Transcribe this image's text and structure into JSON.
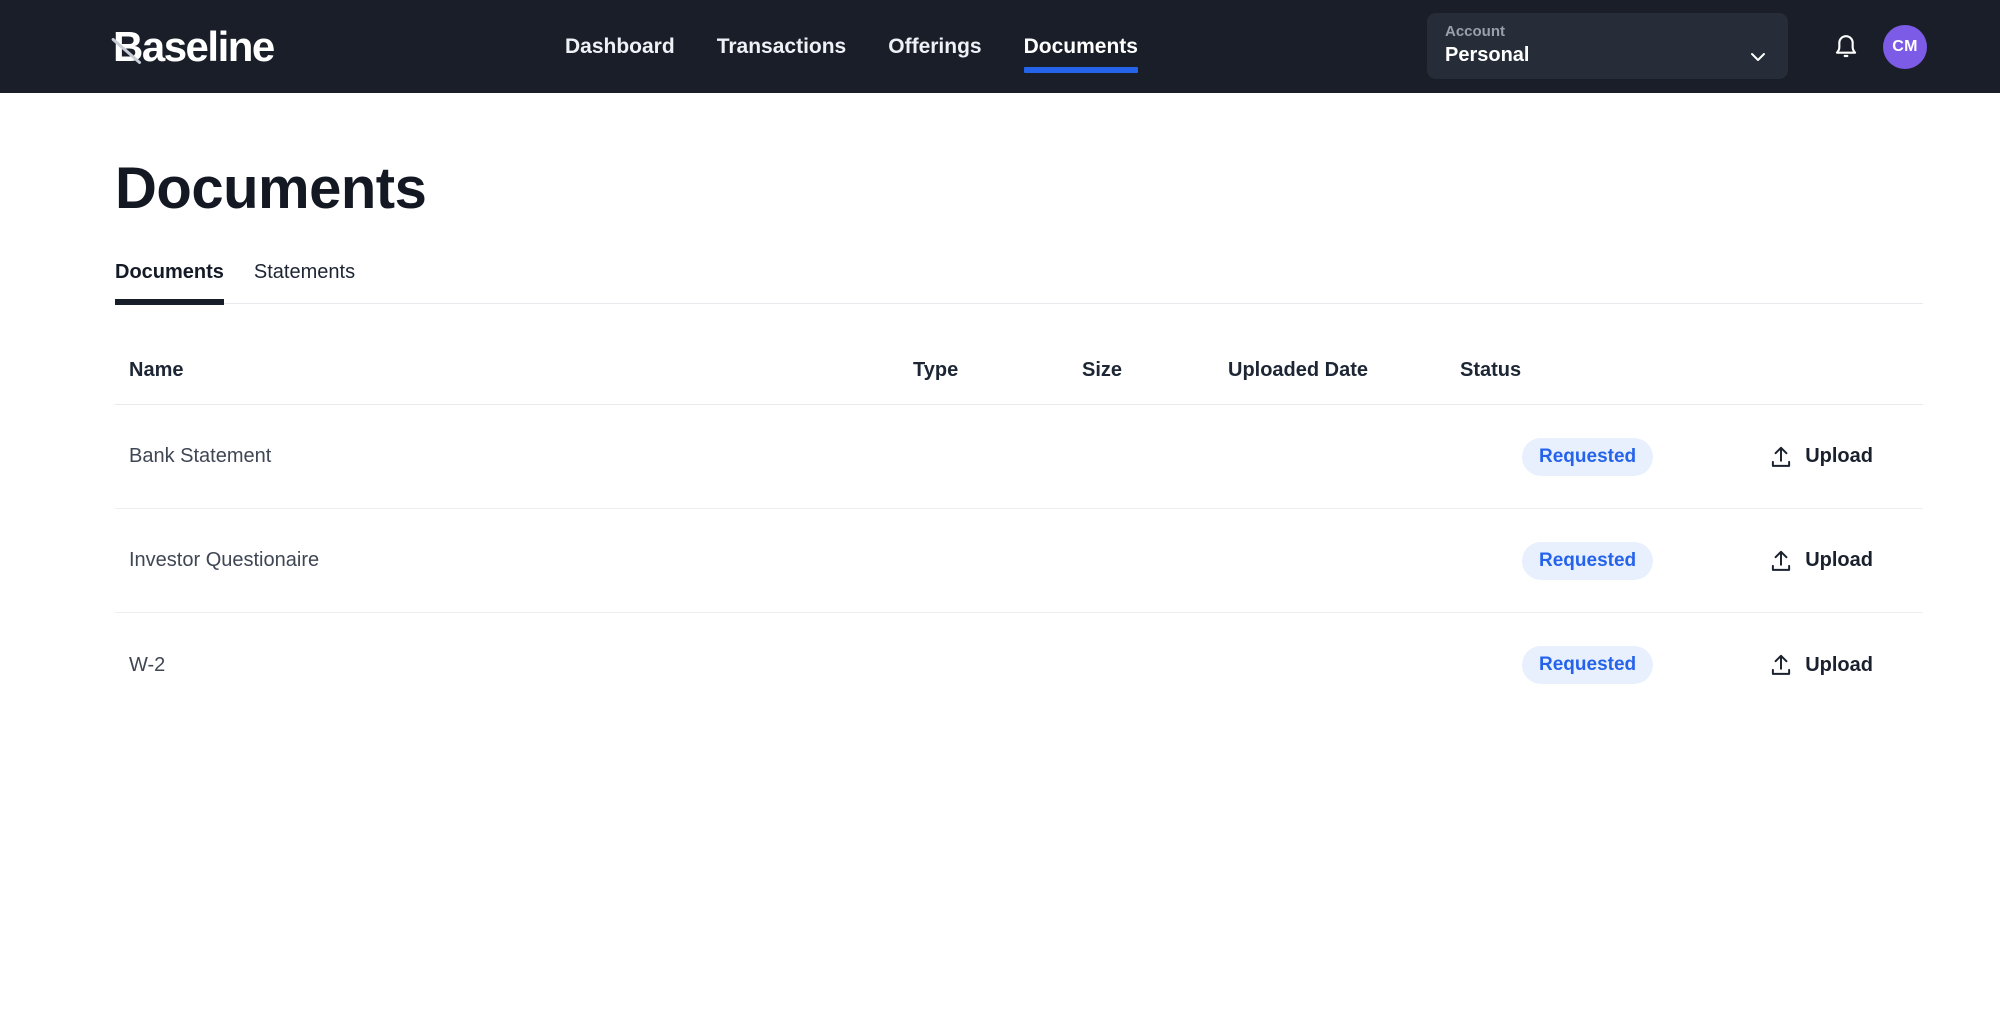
{
  "brand": {
    "name": "Baseline"
  },
  "navbar": {
    "items": [
      {
        "label": "Dashboard",
        "active": false
      },
      {
        "label": "Transactions",
        "active": false
      },
      {
        "label": "Offerings",
        "active": false
      },
      {
        "label": "Documents",
        "active": true
      }
    ],
    "account_selector": {
      "label": "Account",
      "value": "Personal"
    },
    "avatar_initials": "CM"
  },
  "page": {
    "title": "Documents"
  },
  "tabs": [
    {
      "label": "Documents",
      "active": true
    },
    {
      "label": "Statements",
      "active": false
    }
  ],
  "table": {
    "columns": [
      "Name",
      "Type",
      "Size",
      "Uploaded Date",
      "Status"
    ],
    "rows": [
      {
        "name": "Bank Statement",
        "type": "",
        "size": "",
        "uploaded_date": "",
        "status": "Requested",
        "action_label": "Upload"
      },
      {
        "name": "Investor Questionaire",
        "type": "",
        "size": "",
        "uploaded_date": "",
        "status": "Requested",
        "action_label": "Upload"
      },
      {
        "name": "W-2",
        "type": "",
        "size": "",
        "uploaded_date": "",
        "status": "Requested",
        "action_label": "Upload"
      }
    ]
  },
  "colors": {
    "navbar_bg": "#191e29",
    "accent_blue": "#2563eb",
    "account_box_bg": "#272d38",
    "badge_bg": "#e8f0fd",
    "badge_text": "#2563eb",
    "avatar_bg": "#7c5ce6",
    "tab_underline": "#171e2a",
    "divider": "#e7e9ed"
  }
}
